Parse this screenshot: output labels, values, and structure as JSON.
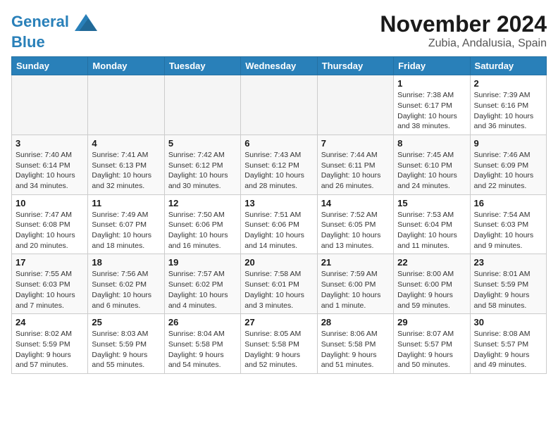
{
  "logo": {
    "line1": "General",
    "line2": "Blue"
  },
  "title": "November 2024",
  "location": "Zubia, Andalusia, Spain",
  "weekdays": [
    "Sunday",
    "Monday",
    "Tuesday",
    "Wednesday",
    "Thursday",
    "Friday",
    "Saturday"
  ],
  "weeks": [
    [
      {
        "day": "",
        "info": ""
      },
      {
        "day": "",
        "info": ""
      },
      {
        "day": "",
        "info": ""
      },
      {
        "day": "",
        "info": ""
      },
      {
        "day": "",
        "info": ""
      },
      {
        "day": "1",
        "info": "Sunrise: 7:38 AM\nSunset: 6:17 PM\nDaylight: 10 hours\nand 38 minutes."
      },
      {
        "day": "2",
        "info": "Sunrise: 7:39 AM\nSunset: 6:16 PM\nDaylight: 10 hours\nand 36 minutes."
      }
    ],
    [
      {
        "day": "3",
        "info": "Sunrise: 7:40 AM\nSunset: 6:14 PM\nDaylight: 10 hours\nand 34 minutes."
      },
      {
        "day": "4",
        "info": "Sunrise: 7:41 AM\nSunset: 6:13 PM\nDaylight: 10 hours\nand 32 minutes."
      },
      {
        "day": "5",
        "info": "Sunrise: 7:42 AM\nSunset: 6:12 PM\nDaylight: 10 hours\nand 30 minutes."
      },
      {
        "day": "6",
        "info": "Sunrise: 7:43 AM\nSunset: 6:12 PM\nDaylight: 10 hours\nand 28 minutes."
      },
      {
        "day": "7",
        "info": "Sunrise: 7:44 AM\nSunset: 6:11 PM\nDaylight: 10 hours\nand 26 minutes."
      },
      {
        "day": "8",
        "info": "Sunrise: 7:45 AM\nSunset: 6:10 PM\nDaylight: 10 hours\nand 24 minutes."
      },
      {
        "day": "9",
        "info": "Sunrise: 7:46 AM\nSunset: 6:09 PM\nDaylight: 10 hours\nand 22 minutes."
      }
    ],
    [
      {
        "day": "10",
        "info": "Sunrise: 7:47 AM\nSunset: 6:08 PM\nDaylight: 10 hours\nand 20 minutes."
      },
      {
        "day": "11",
        "info": "Sunrise: 7:49 AM\nSunset: 6:07 PM\nDaylight: 10 hours\nand 18 minutes."
      },
      {
        "day": "12",
        "info": "Sunrise: 7:50 AM\nSunset: 6:06 PM\nDaylight: 10 hours\nand 16 minutes."
      },
      {
        "day": "13",
        "info": "Sunrise: 7:51 AM\nSunset: 6:06 PM\nDaylight: 10 hours\nand 14 minutes."
      },
      {
        "day": "14",
        "info": "Sunrise: 7:52 AM\nSunset: 6:05 PM\nDaylight: 10 hours\nand 13 minutes."
      },
      {
        "day": "15",
        "info": "Sunrise: 7:53 AM\nSunset: 6:04 PM\nDaylight: 10 hours\nand 11 minutes."
      },
      {
        "day": "16",
        "info": "Sunrise: 7:54 AM\nSunset: 6:03 PM\nDaylight: 10 hours\nand 9 minutes."
      }
    ],
    [
      {
        "day": "17",
        "info": "Sunrise: 7:55 AM\nSunset: 6:03 PM\nDaylight: 10 hours\nand 7 minutes."
      },
      {
        "day": "18",
        "info": "Sunrise: 7:56 AM\nSunset: 6:02 PM\nDaylight: 10 hours\nand 6 minutes."
      },
      {
        "day": "19",
        "info": "Sunrise: 7:57 AM\nSunset: 6:02 PM\nDaylight: 10 hours\nand 4 minutes."
      },
      {
        "day": "20",
        "info": "Sunrise: 7:58 AM\nSunset: 6:01 PM\nDaylight: 10 hours\nand 3 minutes."
      },
      {
        "day": "21",
        "info": "Sunrise: 7:59 AM\nSunset: 6:00 PM\nDaylight: 10 hours\nand 1 minute."
      },
      {
        "day": "22",
        "info": "Sunrise: 8:00 AM\nSunset: 6:00 PM\nDaylight: 9 hours\nand 59 minutes."
      },
      {
        "day": "23",
        "info": "Sunrise: 8:01 AM\nSunset: 5:59 PM\nDaylight: 9 hours\nand 58 minutes."
      }
    ],
    [
      {
        "day": "24",
        "info": "Sunrise: 8:02 AM\nSunset: 5:59 PM\nDaylight: 9 hours\nand 57 minutes."
      },
      {
        "day": "25",
        "info": "Sunrise: 8:03 AM\nSunset: 5:59 PM\nDaylight: 9 hours\nand 55 minutes."
      },
      {
        "day": "26",
        "info": "Sunrise: 8:04 AM\nSunset: 5:58 PM\nDaylight: 9 hours\nand 54 minutes."
      },
      {
        "day": "27",
        "info": "Sunrise: 8:05 AM\nSunset: 5:58 PM\nDaylight: 9 hours\nand 52 minutes."
      },
      {
        "day": "28",
        "info": "Sunrise: 8:06 AM\nSunset: 5:58 PM\nDaylight: 9 hours\nand 51 minutes."
      },
      {
        "day": "29",
        "info": "Sunrise: 8:07 AM\nSunset: 5:57 PM\nDaylight: 9 hours\nand 50 minutes."
      },
      {
        "day": "30",
        "info": "Sunrise: 8:08 AM\nSunset: 5:57 PM\nDaylight: 9 hours\nand 49 minutes."
      }
    ]
  ]
}
